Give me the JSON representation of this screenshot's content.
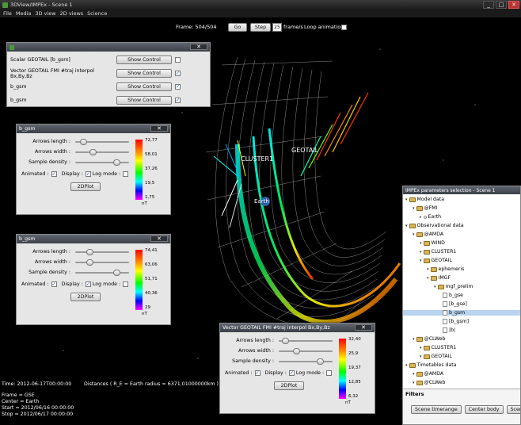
{
  "window": {
    "title": "3DView/IMPEx - Scene 1",
    "min": "_",
    "max": "□",
    "close": "✕"
  },
  "menu": [
    "File",
    "Media",
    "3D view",
    "2D views",
    "Science"
  ],
  "top_controls": {
    "frame_label": "Frame: 504/504",
    "go_label": "Go",
    "step_label": "Step",
    "frame_step_value": "25",
    "frames_label": "frame/s",
    "loop_label": "Loop animation"
  },
  "scene_labels": {
    "cluster": "CLUSTER1",
    "geotail": "GEOTAIL",
    "earth": "Earth"
  },
  "layers_panel": {
    "close": "✕",
    "rows": [
      {
        "label": "Scalar GEOTAIL [b_gsm]",
        "button": "Show Control",
        "checked": false
      },
      {
        "label": "Vector GEOTAIL FMI #traj interpol Bx,By,Bz",
        "button": "Show Control",
        "checked": true
      },
      {
        "label": "b_gsm",
        "button": "Show Control",
        "checked": true
      },
      {
        "label": "b_gsm",
        "button": "Show Control",
        "checked": true
      }
    ]
  },
  "control_panels": [
    {
      "title": "b_gsm",
      "close": "✕",
      "arrows_length": "Arrows length :",
      "arrows_width": "Arrows width :",
      "sample_density": "Sample density :",
      "animated": "Animated :",
      "display": "Display :",
      "log_mode": "Log mode :",
      "plot_button": "2DPlot",
      "ticks": [
        "72,77",
        "58,01",
        "37,26",
        "19,5",
        "1,75"
      ],
      "unit": "nT"
    },
    {
      "title": "b_gsm",
      "close": "✕",
      "arrows_length": "Arrows length :",
      "arrows_width": "Arrows width :",
      "sample_density": "Sample density :",
      "animated": "Animated :",
      "display": "Display :",
      "log_mode": "Log mode :",
      "plot_button": "2DPlot",
      "ticks": [
        "74,41",
        "63,06",
        "51,71",
        "40,36",
        "29"
      ],
      "unit": "nT"
    },
    {
      "title": "Vector GEOTAIL FMI #traj interpol Bx,By,Bz",
      "close": "✕",
      "arrows_length": "Arrows length :",
      "arrows_width": "Arrows width :",
      "sample_density": "Sample density :",
      "animated": "Animated :",
      "display": "Display :",
      "log_mode": "Log mode :",
      "plot_button": "2DPlot",
      "ticks": [
        "32,40",
        "25,9",
        "19,37",
        "12,85",
        "6,32"
      ],
      "unit": "nT"
    }
  ],
  "tree": {
    "title": "IMPEx parameters selection - Scene 1",
    "items": [
      {
        "label": "Model data",
        "kind": "folder",
        "indent": 0
      },
      {
        "label": "@FMI",
        "kind": "folder",
        "indent": 1
      },
      {
        "label": "Earth",
        "kind": "leaf",
        "indent": 2
      },
      {
        "label": "Observational data",
        "kind": "folder",
        "indent": 0
      },
      {
        "label": "@AMDA",
        "kind": "folder",
        "indent": 1
      },
      {
        "label": "WIND",
        "kind": "folder",
        "indent": 2
      },
      {
        "label": "CLUSTER1",
        "kind": "folder",
        "indent": 2
      },
      {
        "label": "GEOTAIL",
        "kind": "folder",
        "indent": 2
      },
      {
        "label": "ephemeris",
        "kind": "folder",
        "indent": 3
      },
      {
        "label": "IMGF",
        "kind": "folder",
        "indent": 3
      },
      {
        "label": "mgf_prelim",
        "kind": "folder",
        "indent": 4
      },
      {
        "label": "b_gse",
        "kind": "file",
        "indent": 5
      },
      {
        "label": "[b_gse]",
        "kind": "file",
        "indent": 5
      },
      {
        "label": "b_gsm",
        "kind": "file",
        "indent": 5,
        "selected": true
      },
      {
        "label": "[b_gsm]",
        "kind": "file",
        "indent": 5
      },
      {
        "label": "|b|",
        "kind": "file",
        "indent": 5
      },
      {
        "label": "@CLWeb",
        "kind": "folder",
        "indent": 1
      },
      {
        "label": "CLUSTER1",
        "kind": "folder",
        "indent": 2
      },
      {
        "label": "GEOTAIL",
        "kind": "folder",
        "indent": 2
      },
      {
        "label": "Timetables data",
        "kind": "folder",
        "indent": 0
      },
      {
        "label": "@AMDA",
        "kind": "folder",
        "indent": 1
      },
      {
        "label": "@CLWeb",
        "kind": "folder",
        "indent": 1
      }
    ],
    "filters_label": "Filters",
    "buttons": [
      "Scene timerange",
      "Center body",
      "Scen"
    ]
  },
  "status": {
    "time": "Time: 2012-06-17T00:00:00",
    "distances": "Distances ( R_E = Earth radius = 6371,01000000km )",
    "frame": "Frame = GSE",
    "center": "Center = Earth",
    "start": "Start = 2012/06/16 00:00:00",
    "stop": "Stop = 2012/06/17 00:00:00"
  },
  "colors": {
    "accent": "#3b4048",
    "selection": "#b9d3f0",
    "scene_bg": "#000000"
  }
}
